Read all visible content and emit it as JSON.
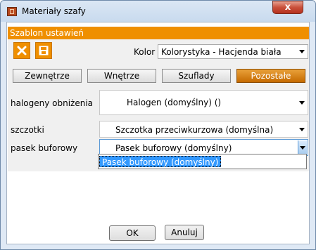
{
  "window": {
    "title": "Materiały szafy",
    "close_symbol": "x"
  },
  "section": {
    "title": "Szablon ustawień"
  },
  "toolbar": {
    "delete_icon": "x-icon",
    "save_icon": "floppy-icon",
    "kolor_label": "Kolor",
    "kolor_value": "Kolorystyka - Hacjenda biała"
  },
  "tabs": [
    {
      "label": "Zewnętrze"
    },
    {
      "label": "Wnętrze"
    },
    {
      "label": "Szuflady"
    },
    {
      "label": "Pozostałe",
      "active": true
    }
  ],
  "fields": [
    {
      "label": "halogeny obniżenia",
      "value": "Halogen (domyślny) ()"
    },
    {
      "label": "szczotki",
      "value": "Szczotka przeciwkurzowa (domyślna)"
    },
    {
      "label": "pasek buforowy",
      "value": "Pasek buforowy (domyślny)"
    }
  ],
  "dropdown": {
    "items": [
      "Pasek buforowy (domyślny)"
    ]
  },
  "buttons": {
    "ok": "OK",
    "cancel": "Anuluj"
  },
  "colors": {
    "accent": "#ef8f00",
    "selection": "#3399ff"
  }
}
